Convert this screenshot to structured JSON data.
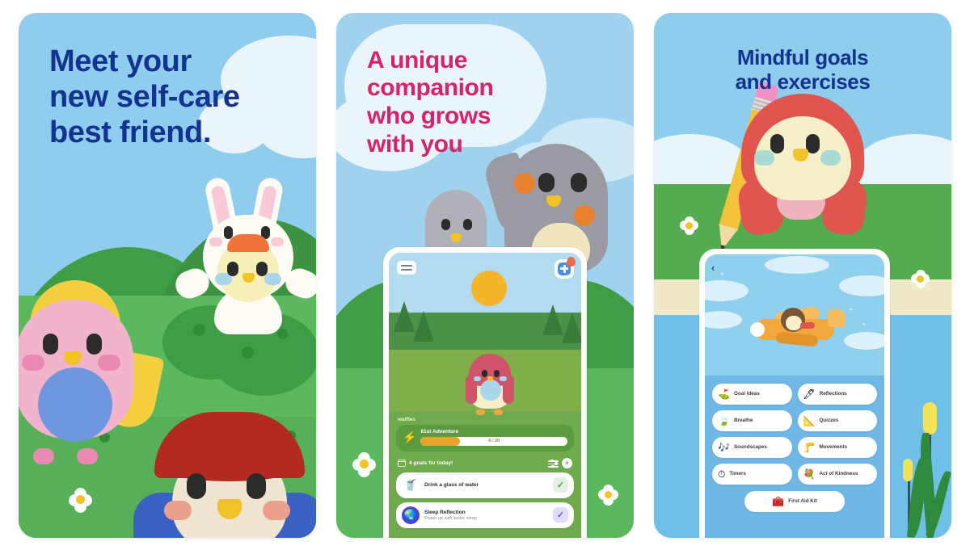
{
  "gallery": {
    "title": "App store screenshot gallery",
    "background_color": "#ffffff",
    "card_count": 3
  },
  "cards": [
    {
      "id": "card-1",
      "headline": "Meet your\nnew self-care\nbest friend.",
      "headline_color": "#12338f",
      "sky_color": "#8fcced",
      "grass_color": "#5cb85c",
      "characters": [
        "pink-bird",
        "bunny-hood-bird",
        "red-hair-bird"
      ]
    },
    {
      "id": "card-2",
      "headline": "A unique\ncompanion\nwho grows\nwith you",
      "headline_color": "#d6236a",
      "sky_color": "#9fd2ef",
      "grass_color": "#5cb85c",
      "characters": [
        "small-penguin",
        "big-penguin"
      ],
      "phone": {
        "menu_icon": "hamburger-icon",
        "badge_icon": "first-aid-badge-icon",
        "pet_name": "waffles",
        "quest": {
          "icon": "lightning-bolt-icon",
          "title": "61st Adventure",
          "progress_label": "6 / 20",
          "progress_percent": 27,
          "fill_color": "#e9a32c"
        },
        "goals_header": {
          "icon": "calendar-icon",
          "label": "4 goals for today!",
          "filter_icon": "sliders-icon",
          "add_icon": "plus-icon"
        },
        "goals": [
          {
            "icon": "glass-of-water-icon",
            "glyph": "🥤",
            "icon_bg": "#ffffff",
            "title": "Drink a glass of water",
            "subtitle": "",
            "check_bg": "#e6efe6",
            "check_color": "#3fa64a",
            "checked": true
          },
          {
            "icon": "sleep-moon-icon",
            "glyph": "🌏",
            "icon_bg": "#4c43d4",
            "title": "Sleep Reflection",
            "subtitle": "Power up with better sleep",
            "check_bg": "#e2dcfb",
            "check_color": "#6a5bd8",
            "checked": true
          }
        ]
      }
    },
    {
      "id": "card-3",
      "headline": "Mindful goals\nand exercises",
      "headline_color": "#12338f",
      "sky_color": "#8ecdec",
      "grass_color": "#55ab4f",
      "characters": [
        "red-bird-with-pencil",
        "bird-pilot-airplane"
      ],
      "phone": {
        "back_icon": "chevron-left-icon",
        "hero_scene": "bird-flying-airplane",
        "buttons": [
          {
            "label": "Goal Ideas",
            "icon": "golf-flag-icon",
            "glyph": "⛳"
          },
          {
            "label": "Reflections",
            "icon": "pen-icon",
            "glyph": "🖋"
          },
          {
            "label": "Breathe",
            "icon": "leaf-wind-icon",
            "glyph": "🍃"
          },
          {
            "label": "Quizzes",
            "icon": "triangle-ruler-icon",
            "glyph": "📐"
          },
          {
            "label": "Soundscapes",
            "icon": "music-notes-icon",
            "glyph": "🎶"
          },
          {
            "label": "Movements",
            "icon": "muscle-icon",
            "glyph": "🦵"
          },
          {
            "label": "Timers",
            "icon": "stopwatch-icon",
            "glyph": "⏱"
          },
          {
            "label": "Act of Kindness",
            "icon": "bouquet-icon",
            "glyph": "💐"
          },
          {
            "label": "First Aid Kit",
            "icon": "first-aid-kit-icon",
            "glyph": "🧰",
            "wide": true
          }
        ]
      }
    }
  ]
}
